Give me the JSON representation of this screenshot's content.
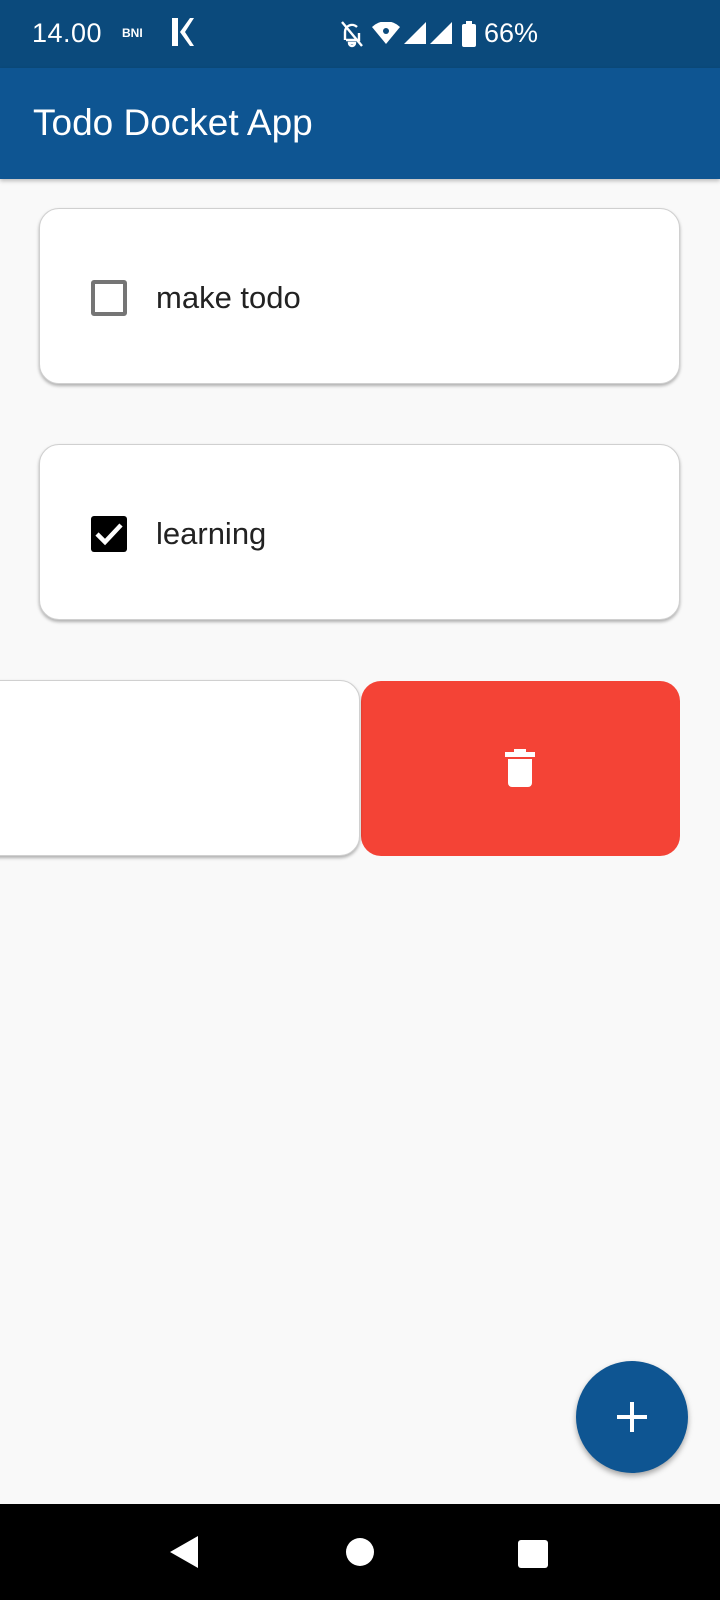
{
  "status_bar": {
    "time": "14.00",
    "carrier_badge": "BNI",
    "battery_percent": "66%",
    "icons": [
      "bni-icon",
      "k-app-icon",
      "notifications-off-icon",
      "wifi-icon",
      "signal-icon",
      "signal-icon",
      "battery-icon"
    ]
  },
  "app_bar": {
    "title": "Todo Docket App",
    "color": "#0e5592"
  },
  "todos": [
    {
      "label": "make todo",
      "checked": false
    },
    {
      "label": "learning",
      "checked": true
    }
  ],
  "swipe_action": {
    "icon": "trash-icon",
    "color": "#f44336"
  },
  "fab": {
    "icon": "plus-icon",
    "color": "#0e5592"
  },
  "nav_bar": {
    "icons": [
      "back-icon",
      "home-icon",
      "recents-icon"
    ]
  }
}
